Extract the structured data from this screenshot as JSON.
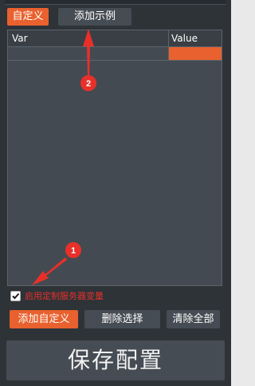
{
  "tabs": [
    {
      "label": "自定义",
      "active": true
    },
    {
      "label": "添加示例",
      "active": false
    }
  ],
  "table": {
    "columns": [
      "Var",
      "Value"
    ],
    "rows": [
      {
        "var": "",
        "value": ""
      }
    ]
  },
  "checkbox": {
    "label": "启用定制服务器变量",
    "checked": true
  },
  "buttons": {
    "add_custom": "添加自定义",
    "delete_selected": "删除选择",
    "clear_all": "清除全部"
  },
  "save_label": "保存配置",
  "annotations": [
    {
      "number": "1",
      "icon": "red-arrow-icon"
    },
    {
      "number": "2",
      "icon": "red-arrow-icon"
    }
  ],
  "colors": {
    "accent": "#e8612e",
    "panel": "#2e3338",
    "control": "#464c53",
    "warning_text": "#e5302a",
    "annotation": "#e8302a"
  }
}
